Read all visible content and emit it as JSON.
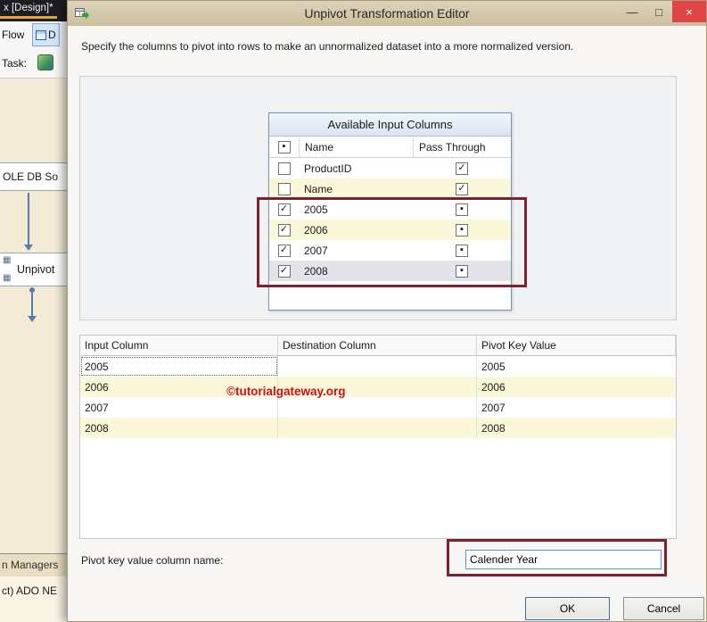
{
  "left_window": {
    "tab_title": "x [Design]*",
    "flow_tab_fragment": "Flow",
    "dataflow_tab_fragment": "D",
    "task_label_fragment": "Task:",
    "ole_db_source_fragment": "OLE DB So",
    "unpivot_box_label": "Unpivot",
    "connection_managers_fragment": "n Managers",
    "ado_net_fragment": "ct) ADO NE"
  },
  "dialog": {
    "title": "Unpivot Transformation Editor",
    "description": "Specify the columns to pivot into rows to make an unnormalized dataset into a more normalized version.",
    "controls": {
      "minimize": "—",
      "maximize": "□",
      "close": "×"
    }
  },
  "available_columns": {
    "title": "Available Input Columns",
    "select_all_glyph": "▪",
    "columns": {
      "name": "Name",
      "pass_through": "Pass Through"
    },
    "rows": [
      {
        "check": "",
        "name": "ProductID",
        "pass": "✓"
      },
      {
        "check": "",
        "name": "Name",
        "pass": "✓"
      },
      {
        "check": "✓",
        "name": "2005",
        "pass": "▪"
      },
      {
        "check": "✓",
        "name": "2006",
        "pass": "▪"
      },
      {
        "check": "✓",
        "name": "2007",
        "pass": "▪"
      },
      {
        "check": "✓",
        "name": "2008",
        "pass": "▪"
      }
    ]
  },
  "mapping_grid": {
    "headers": {
      "input": "Input Column",
      "destination": "Destination Column",
      "pivot_key": "Pivot Key Value"
    },
    "rows": [
      {
        "input": "2005",
        "destination": "",
        "pivot_key": "2005"
      },
      {
        "input": "2006",
        "destination": "",
        "pivot_key": "2006"
      },
      {
        "input": "2007",
        "destination": "",
        "pivot_key": "2007"
      },
      {
        "input": "2008",
        "destination": "",
        "pivot_key": "2008"
      }
    ]
  },
  "watermark": "©tutorialgateway.org",
  "footer": {
    "pivot_key_label": "Pivot key value column name:",
    "pivot_key_value": "Calender Year",
    "ok_label": "OK",
    "cancel_label": "Cancel"
  },
  "icons": {
    "unpivot_grid": "▦"
  },
  "colors": {
    "highlight_red": "#7d2130",
    "titlebar_tan": "#d3c6a8",
    "close_red": "#e04545",
    "row_yellow": "#fbf8da"
  }
}
